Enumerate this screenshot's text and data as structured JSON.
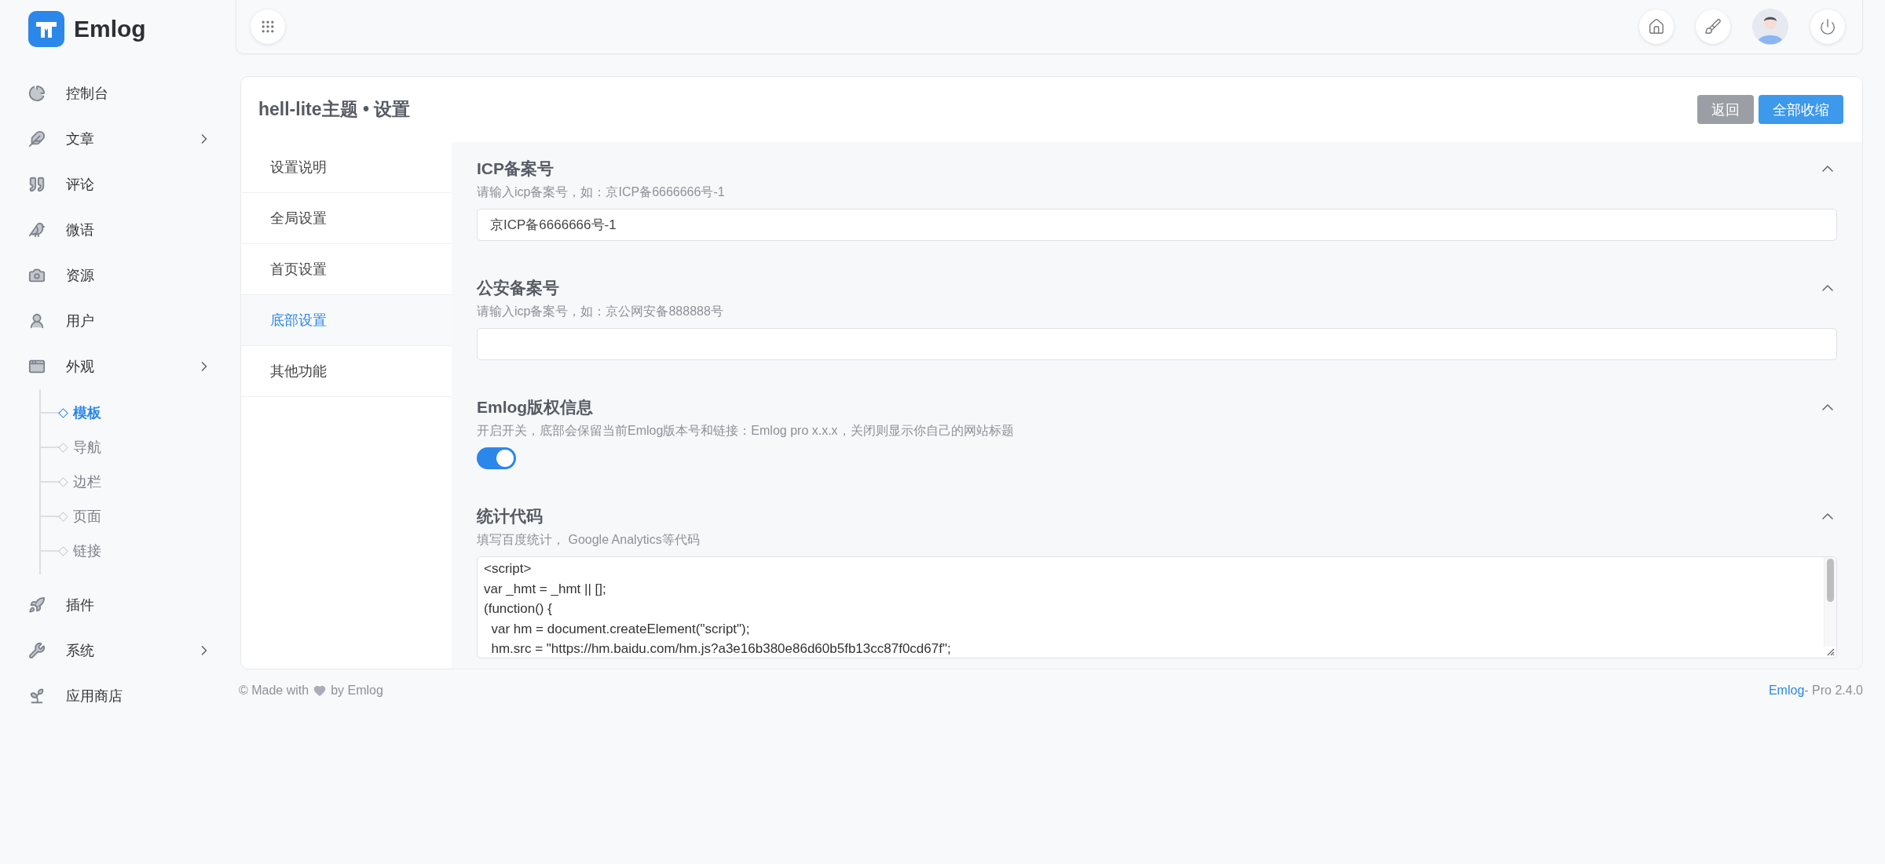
{
  "brand": {
    "name": "Emlog"
  },
  "sidebar": {
    "items": [
      {
        "label": "控制台",
        "has_submenu": false
      },
      {
        "label": "文章",
        "has_submenu": true
      },
      {
        "label": "评论",
        "has_submenu": false
      },
      {
        "label": "微语",
        "has_submenu": false
      },
      {
        "label": "资源",
        "has_submenu": false
      },
      {
        "label": "用户",
        "has_submenu": false
      },
      {
        "label": "外观",
        "has_submenu": true,
        "children": [
          {
            "label": "模板",
            "selected": true
          },
          {
            "label": "导航",
            "selected": false
          },
          {
            "label": "边栏",
            "selected": false
          },
          {
            "label": "页面",
            "selected": false
          },
          {
            "label": "链接",
            "selected": false
          }
        ]
      },
      {
        "label": "插件",
        "has_submenu": false
      },
      {
        "label": "系统",
        "has_submenu": true
      },
      {
        "label": "应用商店",
        "has_submenu": false
      }
    ]
  },
  "page": {
    "title": "hell-lite主题 • 设置",
    "buttons": [
      {
        "label": "返回",
        "kind": "secondary"
      },
      {
        "label": "全部收缩",
        "kind": "primary"
      }
    ]
  },
  "tabs": [
    {
      "label": "设置说明",
      "selected": false
    },
    {
      "label": "全局设置",
      "selected": false
    },
    {
      "label": "首页设置",
      "selected": false
    },
    {
      "label": "底部设置",
      "selected": true
    },
    {
      "label": "其他功能",
      "selected": false
    }
  ],
  "sections": [
    {
      "kind": "text",
      "title": "ICP备案号",
      "description": "请输入icp备案号，如：京ICP备6666666号-1",
      "expanded": true,
      "value": "京ICP备6666666号-1"
    },
    {
      "kind": "text",
      "title": "公安备案号",
      "description": "请输入icp备案号，如：京公网安备888888号",
      "expanded": true
    },
    {
      "kind": "toggle",
      "title": "Emlog版权信息",
      "description": "开启开关，底部会保留当前Emlog版本号和链接：Emlog pro x.x.x，关闭则显示你自己的网站标题",
      "expanded": true,
      "on": true
    },
    {
      "kind": "code",
      "title": "统计代码",
      "description": "填写百度统计， Google Analytics等代码",
      "expanded": true,
      "value": "<script>\nvar _hmt = _hmt || [];\n(function() {\n  var hm = document.createElement(\"script\");\n  hm.src = \"https://hm.baidu.com/hm.js?a3e16b380e86d60b5fb13cc87f0cd67f\";"
    }
  ],
  "footer": {
    "left_before": "© Made with",
    "left_after": "by Emlog",
    "right_link": "Emlog",
    "right_text": "- Pro 2.4.0"
  }
}
